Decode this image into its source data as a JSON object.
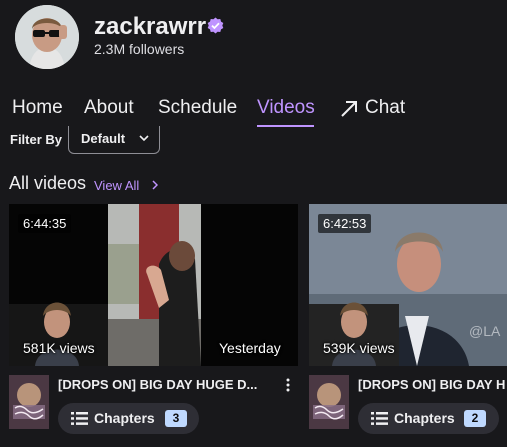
{
  "channel": {
    "name": "zackrawrr",
    "followers": "2.3M followers",
    "verified_color": "#bf94ff"
  },
  "tabs": [
    {
      "label": "Home",
      "active": false
    },
    {
      "label": "About",
      "active": false
    },
    {
      "label": "Schedule",
      "active": false
    },
    {
      "label": "Videos",
      "active": true
    },
    {
      "label": "Chat",
      "active": false,
      "icon": "arrow-up-right-icon"
    }
  ],
  "filter": {
    "label": "Filter By",
    "selected": "Default"
  },
  "section": {
    "title": "All videos",
    "view_all": "View All"
  },
  "videos": [
    {
      "duration": "6:44:35",
      "views": "581K views",
      "date": "Yesterday",
      "title": "[DROPS ON] BIG DAY HUGE D...",
      "chapters_label": "Chapters",
      "chapters_count": "3"
    },
    {
      "duration": "6:42:53",
      "views": "539K views",
      "date": "",
      "title": "[DROPS ON] BIG DAY H",
      "chapters_label": "Chapters",
      "chapters_count": "2"
    }
  ],
  "colors": {
    "background": "#18181b",
    "accent": "#bf94ff",
    "chapters_badge": "#bfd9ff"
  }
}
